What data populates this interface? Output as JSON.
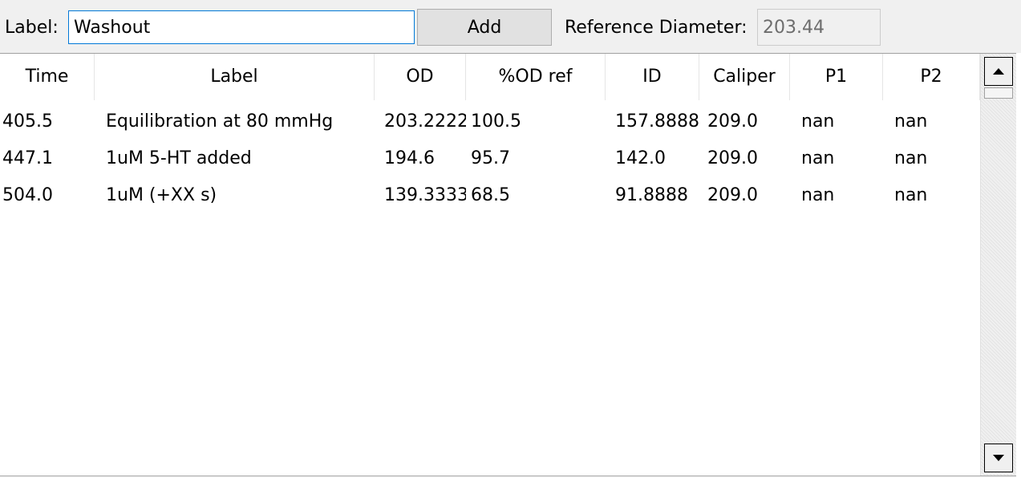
{
  "toolbar": {
    "label_caption": "Label:",
    "label_value": "Washout",
    "add_label": "Add",
    "ref_caption": "Reference Diameter:",
    "ref_value": "203.44"
  },
  "table": {
    "columns": [
      "Time",
      "Label",
      "OD",
      "%OD ref",
      "ID",
      "Caliper",
      "P1",
      "P2"
    ],
    "rows": [
      [
        "405.5",
        "Equilibration at 80 mmHg",
        "203.2222",
        "100.5",
        "157.8888",
        "209.0",
        "nan",
        "nan"
      ],
      [
        "447.1",
        "1uM 5-HT added",
        "194.6",
        "95.7",
        "142.0",
        "209.0",
        "nan",
        "nan"
      ],
      [
        "504.0",
        "1uM (+XX s)",
        "139.3333",
        "68.5",
        "91.8888",
        "209.0",
        "nan",
        "nan"
      ]
    ]
  },
  "icons": {
    "scroll_up": "triangle-up",
    "scroll_down": "triangle-down"
  },
  "colors": {
    "input_focus_border": "#0078d7",
    "button_bg": "#e1e1e1",
    "toolbar_bg": "#f0f0f0"
  }
}
